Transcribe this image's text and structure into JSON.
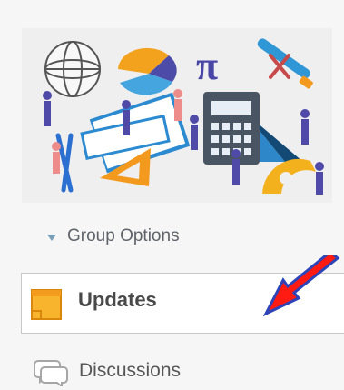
{
  "sidebar": {
    "banner": {
      "image_name": "math-tools-illustration",
      "symbol": "π"
    },
    "group_options": {
      "label": "Group Options",
      "icon": "triangle-down-icon",
      "icon_color": "#7a9db8"
    },
    "items": [
      {
        "label": "Updates",
        "icon": "updates-icon",
        "selected": true
      },
      {
        "label": "Discussions",
        "icon": "discussion-icon",
        "selected": false
      }
    ]
  },
  "annotation": {
    "arrow_color": "#ff1a12",
    "arrow_outline": "#2d43b8"
  }
}
